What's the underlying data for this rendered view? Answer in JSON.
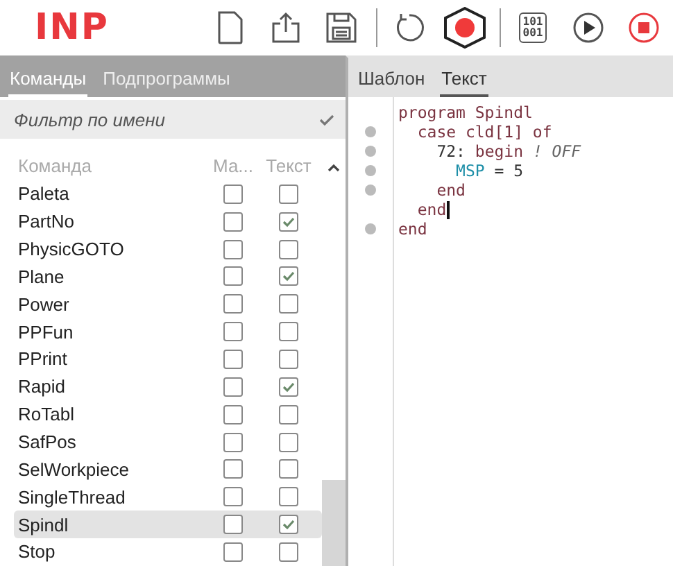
{
  "app": {
    "logo": "INP"
  },
  "toolbar": [
    {
      "kind": "new"
    },
    {
      "kind": "upload"
    },
    {
      "kind": "save"
    },
    {
      "kind": "divider"
    },
    {
      "kind": "undo"
    },
    {
      "kind": "record"
    },
    {
      "kind": "divider"
    },
    {
      "kind": "binary",
      "lines": [
        "101",
        "001"
      ]
    },
    {
      "kind": "play"
    },
    {
      "kind": "stop"
    }
  ],
  "left_tabs": [
    {
      "label": "Команды",
      "selected": true
    },
    {
      "label": "Подпрограммы",
      "selected": false
    }
  ],
  "filter": {
    "placeholder": "Фильтр по имени"
  },
  "table": {
    "columns": [
      "Команда",
      "Ма...",
      "Текст"
    ],
    "rows": [
      {
        "name": "Paleta",
        "col2": false,
        "text": false,
        "selected": false
      },
      {
        "name": "PartNo",
        "col2": false,
        "text": true,
        "selected": false
      },
      {
        "name": "PhysicGOTO",
        "col2": false,
        "text": false,
        "selected": false
      },
      {
        "name": "Plane",
        "col2": false,
        "text": true,
        "selected": false
      },
      {
        "name": "Power",
        "col2": false,
        "text": false,
        "selected": false
      },
      {
        "name": "PPFun",
        "col2": false,
        "text": false,
        "selected": false
      },
      {
        "name": "PPrint",
        "col2": false,
        "text": false,
        "selected": false
      },
      {
        "name": "Rapid",
        "col2": false,
        "text": true,
        "selected": false
      },
      {
        "name": "RoTabl",
        "col2": false,
        "text": false,
        "selected": false
      },
      {
        "name": "SafPos",
        "col2": false,
        "text": false,
        "selected": false
      },
      {
        "name": "SelWorkpiece",
        "col2": false,
        "text": false,
        "selected": false
      },
      {
        "name": "SingleThread",
        "col2": false,
        "text": false,
        "selected": false
      },
      {
        "name": "Spindl",
        "col2": false,
        "text": true,
        "selected": true
      },
      {
        "name": "Stop",
        "col2": false,
        "text": false,
        "selected": false
      }
    ]
  },
  "right_tabs": [
    {
      "label": "Шаблон",
      "selected": false
    },
    {
      "label": "Текст",
      "selected": true
    }
  ],
  "editor": {
    "lines": [
      {
        "marker": false,
        "cursor": false,
        "tokens": [
          {
            "kind": "kw",
            "text": "program Spindl"
          }
        ]
      },
      {
        "marker": true,
        "cursor": false,
        "tokens": [
          {
            "kind": "kw",
            "text": "  case cld[1] of"
          }
        ]
      },
      {
        "marker": true,
        "cursor": false,
        "tokens": [
          {
            "kind": "plain",
            "text": "    72: "
          },
          {
            "kind": "kw",
            "text": "begin "
          },
          {
            "kind": "comment",
            "text": "! OFF"
          }
        ]
      },
      {
        "marker": true,
        "cursor": false,
        "tokens": [
          {
            "kind": "var",
            "text": "      MSP"
          },
          {
            "kind": "plain",
            "text": " = 5"
          }
        ]
      },
      {
        "marker": true,
        "cursor": false,
        "tokens": [
          {
            "kind": "kw",
            "text": "    end"
          }
        ]
      },
      {
        "marker": false,
        "cursor": true,
        "tokens": [
          {
            "kind": "kw",
            "text": "  end"
          }
        ]
      },
      {
        "marker": true,
        "cursor": false,
        "tokens": [
          {
            "kind": "kw",
            "text": "end"
          }
        ]
      }
    ]
  }
}
